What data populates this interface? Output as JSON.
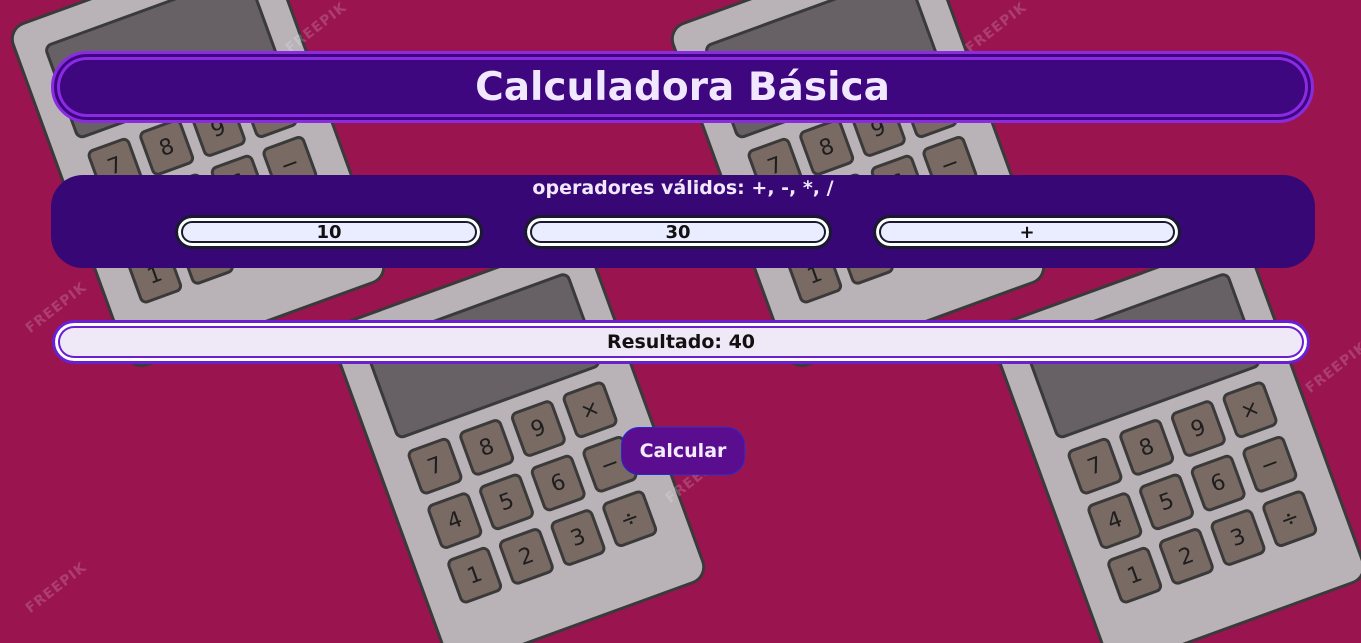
{
  "header": {
    "title": "Calculadora Básica"
  },
  "inputs": {
    "hint": "operadores válidos: +, -, *, /",
    "first_number": "10",
    "second_number": "30",
    "operator": "+"
  },
  "result": {
    "label": "Resultado: 40"
  },
  "actions": {
    "calculate_label": "Calcular"
  },
  "background": {
    "watermark": "FREEPIK",
    "calculator_keys": [
      "7",
      "8",
      "9",
      "×",
      "4",
      "5",
      "6",
      "−",
      "1",
      "2",
      "3",
      "÷"
    ]
  }
}
